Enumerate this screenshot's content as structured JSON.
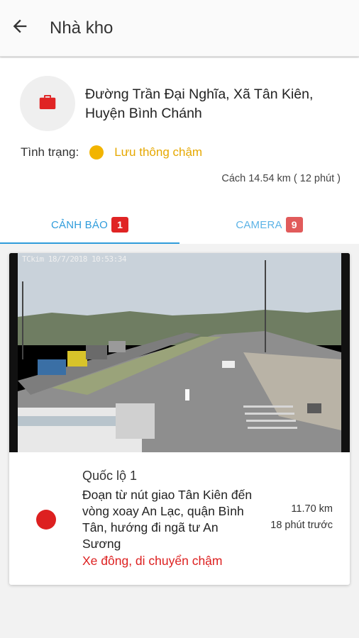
{
  "appbar": {
    "title": "Nhà kho",
    "back_icon": "arrow-left-icon"
  },
  "location": {
    "icon": "briefcase-icon",
    "icon_color": "#e02424",
    "address": "Đường Trần Đại Nghĩa, Xã Tân Kiên, Huyện Bình Chánh",
    "status_label": "Tình trạng:",
    "status_value": "Lưu thông chậm",
    "status_color": "#f2b400",
    "distance": "Cách 14.54 km ( 12 phút )"
  },
  "tabs": [
    {
      "label": "CẢNH BÁO",
      "badge": "1",
      "active": true
    },
    {
      "label": "CAMERA",
      "badge": "9",
      "active": false
    }
  ],
  "alert": {
    "camera_overlay": "TCkim   18/7/2018  10:53:34",
    "road": "Quốc lộ 1",
    "segment": "Đoạn từ nút giao Tân Kiên đến vòng xoay An Lạc, quận Bình Tân, hướng đi ngã tư An Sương",
    "status": "Xe đông, di chuyển chậm",
    "severity_color": "#dd2020",
    "distance": "11.70 km",
    "time_ago": "18 phút trước"
  }
}
